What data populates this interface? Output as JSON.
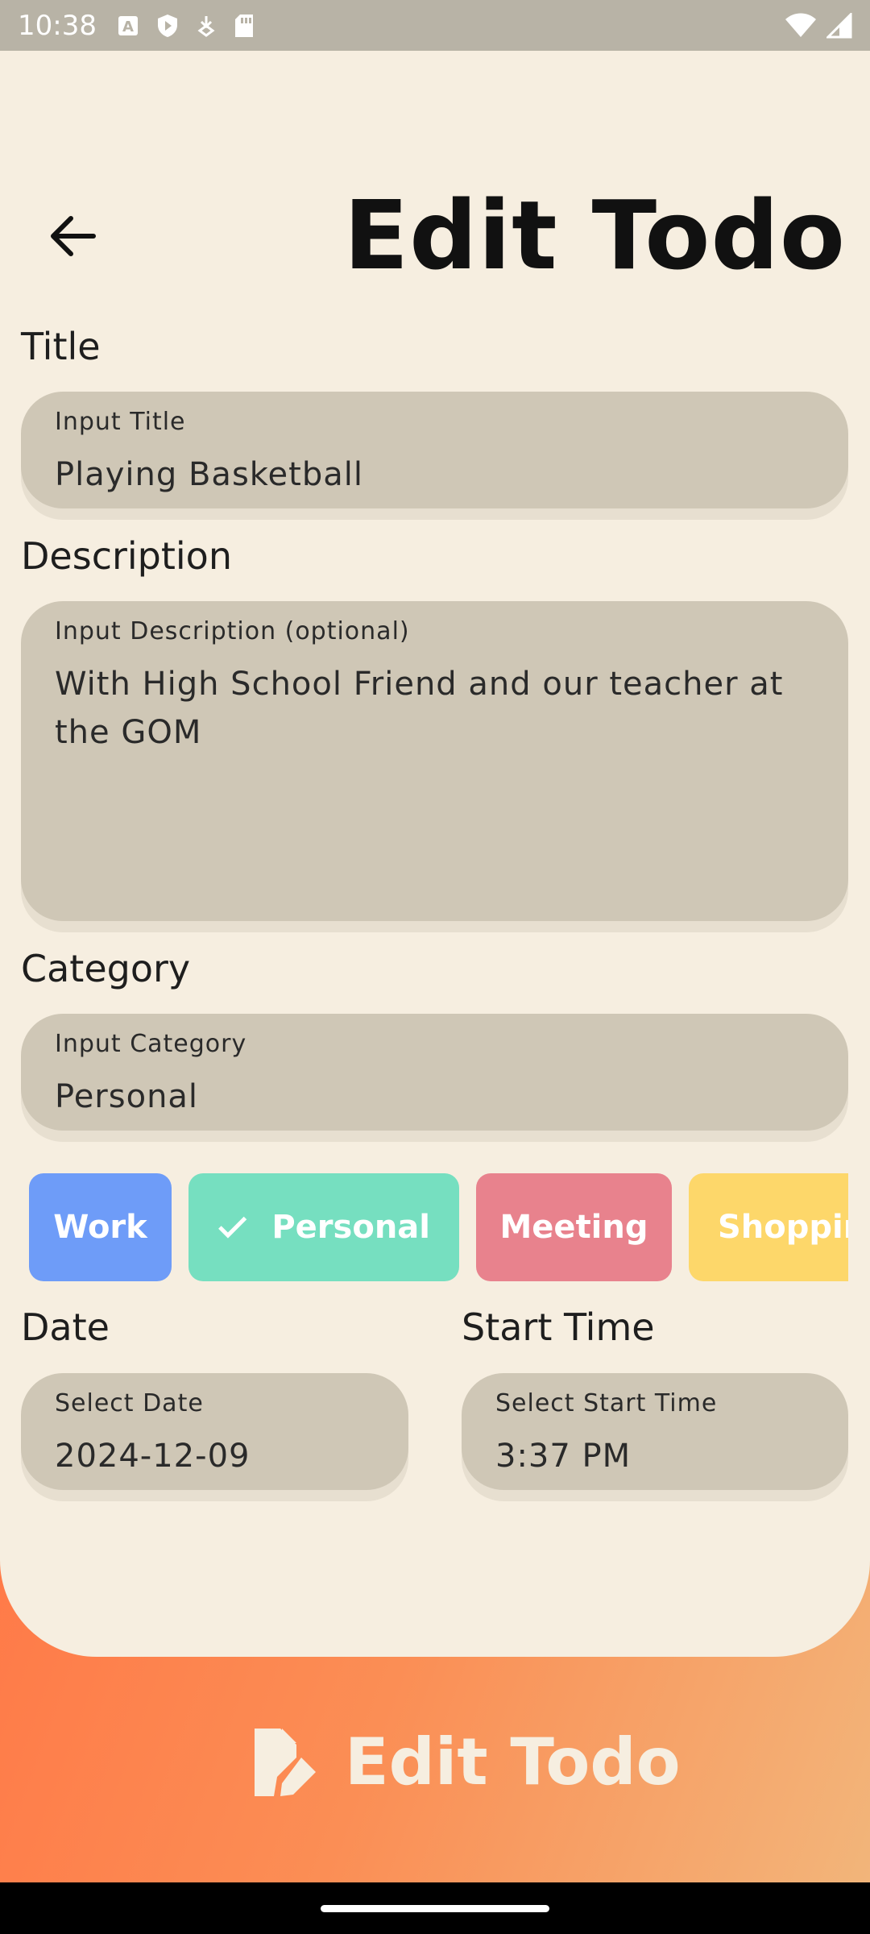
{
  "status_bar": {
    "time": "10:38"
  },
  "header": {
    "title": "Edit Todo",
    "back_icon": "arrow-left-icon"
  },
  "form": {
    "title_section": {
      "label": "Title",
      "field_label": "Input Title",
      "value": "Playing Basketball"
    },
    "description_section": {
      "label": "Description",
      "field_label": "Input Description (optional)",
      "value": "With High School Friend and our teacher at the GOM"
    },
    "category_section": {
      "label": "Category",
      "field_label": "Input Category",
      "value": "Personal"
    },
    "category_chips": [
      {
        "label": "Work",
        "color": "#6e9cf8",
        "selected": false
      },
      {
        "label": "Personal",
        "color": "#76dfc0",
        "selected": true
      },
      {
        "label": "Meeting",
        "color": "#e8828d",
        "selected": false
      },
      {
        "label": "Shopping",
        "color": "#fdd76a",
        "selected": false
      }
    ],
    "date_section": {
      "label": "Date",
      "field_label": "Select Date",
      "value": "2024-12-09"
    },
    "time_section": {
      "label": "Start Time",
      "field_label": "Select Start Time",
      "value": "3:37 PM"
    }
  },
  "footer_button": {
    "label": "Edit Todo",
    "icon": "edit-document-icon"
  },
  "colors": {
    "background": "#f6eee0",
    "field": "#cfc7b6",
    "gradient_start": "#ff7a48",
    "gradient_end": "#f2b57a"
  }
}
